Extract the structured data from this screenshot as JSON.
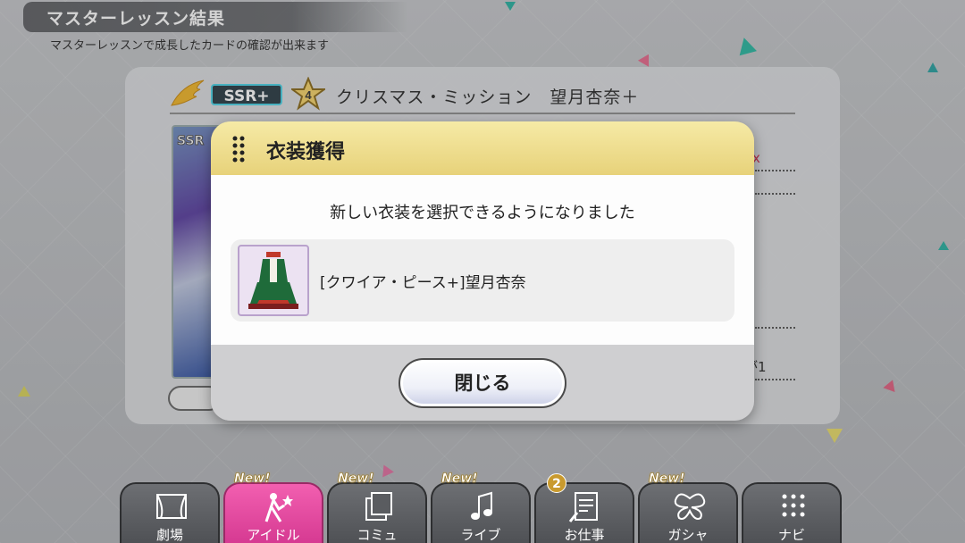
{
  "header": {
    "title": "マスターレッスン結果",
    "subtitle": "マスターレッスンで成長したカードの確認が出来ます"
  },
  "card": {
    "rarity": "SSR+",
    "star_number": "4",
    "name": "クリスマス・ミッション　望月杏奈＋",
    "art_label": "SSR",
    "side_text_1": "x",
    "side_text_2": "アが1"
  },
  "dialog": {
    "title": "衣装獲得",
    "message": "新しい衣装を選択できるようになりました",
    "item_name": "[クワイア・ピース+]望月杏奈",
    "close_label": "閉じる"
  },
  "nav": {
    "tabs": [
      {
        "label": "劇場",
        "icon": "theater-icon",
        "new": ""
      },
      {
        "label": "アイドル",
        "icon": "idol-icon",
        "new": "New!"
      },
      {
        "label": "コミュ",
        "icon": "commu-icon",
        "new": "New!"
      },
      {
        "label": "ライブ",
        "icon": "live-icon",
        "new": "New!"
      },
      {
        "label": "お仕事",
        "icon": "work-icon",
        "new": "",
        "count": "2"
      },
      {
        "label": "ガシャ",
        "icon": "gacha-icon",
        "new": "New!"
      },
      {
        "label": "ナビ",
        "icon": "navi-icon",
        "new": ""
      }
    ]
  },
  "colors": {
    "dialog_header": "#e7d27a",
    "active_tab": "#e24ca2",
    "rarity_border": "#4cd2e6"
  }
}
